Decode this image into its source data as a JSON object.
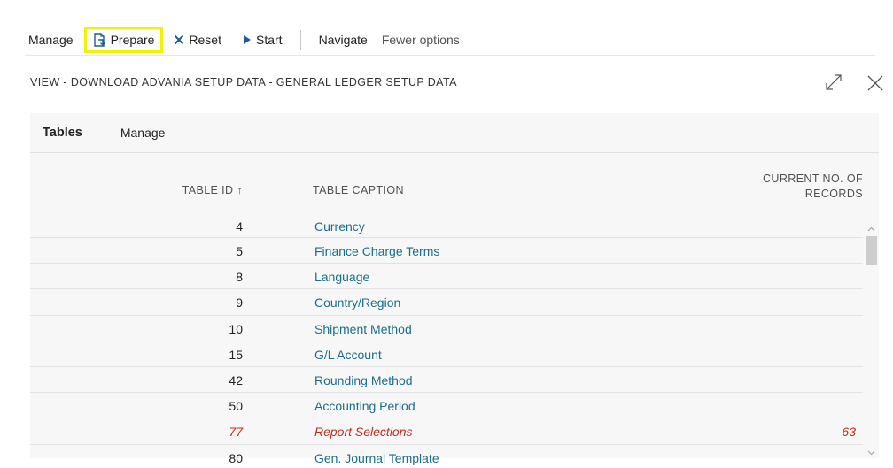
{
  "actions": {
    "manage": "Manage",
    "prepare": "Prepare",
    "reset": "Reset",
    "start": "Start",
    "navigate": "Navigate",
    "fewer_options": "Fewer options"
  },
  "page_title": "VIEW - DOWNLOAD ADVANIA SETUP DATA - GENERAL LEDGER SETUP DATA",
  "subpage": {
    "tab_tables": "Tables",
    "tab_manage": "Manage"
  },
  "columns": {
    "table_id": "TABLE ID ↑",
    "table_caption": "TABLE CAPTION",
    "records_line1": "CURRENT NO. OF",
    "records_line2": "RECORDS"
  },
  "rows": [
    {
      "id": "4",
      "caption": "Currency",
      "records": ""
    },
    {
      "id": "5",
      "caption": "Finance Charge Terms",
      "records": ""
    },
    {
      "id": "8",
      "caption": "Language",
      "records": ""
    },
    {
      "id": "9",
      "caption": "Country/Region",
      "records": ""
    },
    {
      "id": "10",
      "caption": "Shipment Method",
      "records": ""
    },
    {
      "id": "15",
      "caption": "G/L Account",
      "records": ""
    },
    {
      "id": "42",
      "caption": "Rounding Method",
      "records": ""
    },
    {
      "id": "50",
      "caption": "Accounting Period",
      "records": ""
    },
    {
      "id": "77",
      "caption": "Report Selections",
      "records": "63"
    },
    {
      "id": "80",
      "caption": "Gen. Journal Template",
      "records": ""
    }
  ],
  "colors": {
    "highlight": "#f2f200",
    "link": "#1a6e8c",
    "alert": "#c42b1c",
    "action_icon": "#1d5b9a"
  }
}
